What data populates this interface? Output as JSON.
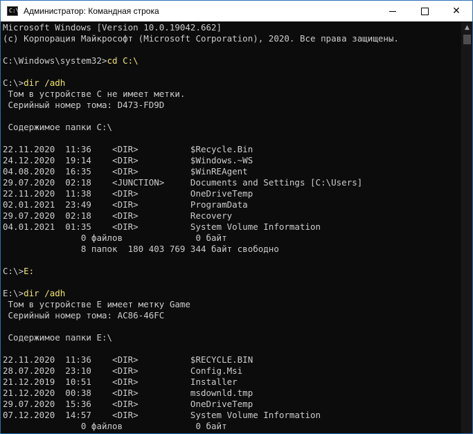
{
  "window": {
    "title": "Администратор: Командная строка",
    "icon_glyph": "C:\\",
    "controls": {
      "minimize": "minimize-icon",
      "maximize": "maximize-icon",
      "close": "✕"
    }
  },
  "colors": {
    "background": "#0c0c0c",
    "text": "#cccccc",
    "command": "#f0e66e"
  },
  "console": {
    "lines": [
      {
        "prompt": "Microsoft Windows [Version 10.0.19042.662]",
        "cmd": ""
      },
      {
        "prompt": "(c) Корпорация Майкрософт (Microsoft Corporation), 2020. Все права защищены.",
        "cmd": ""
      },
      {
        "prompt": "",
        "cmd": ""
      },
      {
        "prompt": "C:\\Windows\\system32>",
        "cmd": "cd C:\\"
      },
      {
        "prompt": "",
        "cmd": ""
      },
      {
        "prompt": "C:\\>",
        "cmd": "dir /adh"
      },
      {
        "prompt": " Том в устройстве C не имеет метки.",
        "cmd": ""
      },
      {
        "prompt": " Серийный номер тома: D473-FD9D",
        "cmd": ""
      },
      {
        "prompt": "",
        "cmd": ""
      },
      {
        "prompt": " Содержимое папки C:\\",
        "cmd": ""
      },
      {
        "prompt": "",
        "cmd": ""
      },
      {
        "prompt": "22.11.2020  11:36    <DIR>          $Recycle.Bin",
        "cmd": ""
      },
      {
        "prompt": "24.12.2020  19:14    <DIR>          $Windows.~WS",
        "cmd": ""
      },
      {
        "prompt": "04.08.2020  16:35    <DIR>          $WinREAgent",
        "cmd": ""
      },
      {
        "prompt": "29.07.2020  02:18    <JUNCTION>     Documents and Settings [C:\\Users]",
        "cmd": ""
      },
      {
        "prompt": "22.11.2020  11:38    <DIR>          OneDriveTemp",
        "cmd": ""
      },
      {
        "prompt": "02.01.2021  23:49    <DIR>          ProgramData",
        "cmd": ""
      },
      {
        "prompt": "29.07.2020  02:18    <DIR>          Recovery",
        "cmd": ""
      },
      {
        "prompt": "04.01.2021  01:35    <DIR>          System Volume Information",
        "cmd": ""
      },
      {
        "prompt": "               0 файлов              0 байт",
        "cmd": ""
      },
      {
        "prompt": "               8 папок  180 403 769 344 байт свободно",
        "cmd": ""
      },
      {
        "prompt": "",
        "cmd": ""
      },
      {
        "prompt": "C:\\>",
        "cmd": "E:"
      },
      {
        "prompt": "",
        "cmd": ""
      },
      {
        "prompt": "E:\\>",
        "cmd": "dir /adh"
      },
      {
        "prompt": " Том в устройстве E имеет метку Game",
        "cmd": ""
      },
      {
        "prompt": " Серийный номер тома: AC86-46FC",
        "cmd": ""
      },
      {
        "prompt": "",
        "cmd": ""
      },
      {
        "prompt": " Содержимое папки E:\\",
        "cmd": ""
      },
      {
        "prompt": "",
        "cmd": ""
      },
      {
        "prompt": "22.11.2020  11:36    <DIR>          $RECYCLE.BIN",
        "cmd": ""
      },
      {
        "prompt": "28.07.2020  23:10    <DIR>          Config.Msi",
        "cmd": ""
      },
      {
        "prompt": "21.12.2019  10:51    <DIR>          Installer",
        "cmd": ""
      },
      {
        "prompt": "21.12.2020  00:38    <DIR>          msdownld.tmp",
        "cmd": ""
      },
      {
        "prompt": "29.07.2020  15:36    <DIR>          OneDriveTemp",
        "cmd": ""
      },
      {
        "prompt": "07.12.2020  14:57    <DIR>          System Volume Information",
        "cmd": ""
      },
      {
        "prompt": "               0 файлов              0 байт",
        "cmd": ""
      }
    ]
  },
  "scrollbar": {
    "up_arrow_icon": "▲"
  }
}
